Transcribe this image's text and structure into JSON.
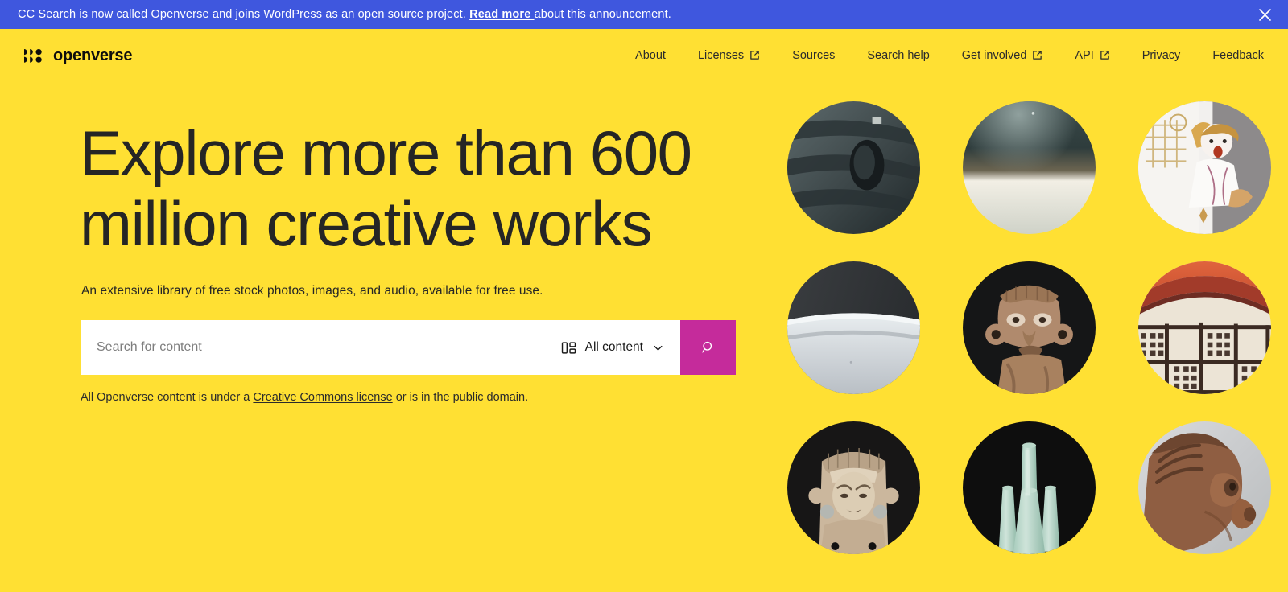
{
  "banner": {
    "text_before": "CC Search is now called Openverse and joins WordPress as an open source project. ",
    "link_label": "Read more ",
    "text_after": "about this announcement.",
    "close_icon": "close-icon",
    "background_color": "#3F57DE",
    "text_color": "#FFFFFF"
  },
  "header": {
    "brand_name": "openverse",
    "logo_icon": "openverse-logo-icon",
    "background_color": "#FFE033",
    "nav": [
      {
        "label": "About",
        "external": false
      },
      {
        "label": "Licenses",
        "external": true
      },
      {
        "label": "Sources",
        "external": false
      },
      {
        "label": "Search help",
        "external": false
      },
      {
        "label": "Get involved",
        "external": true
      },
      {
        "label": "API",
        "external": true
      },
      {
        "label": "Privacy",
        "external": false
      },
      {
        "label": "Feedback",
        "external": false
      }
    ]
  },
  "hero": {
    "headline": "Explore more than 600 million creative works",
    "subheadline": "An extensive library of free stock photos, images, and audio, available for free use.",
    "license_note_before": "All Openverse content is under a ",
    "license_note_link": "Creative Commons license",
    "license_note_after": " or is in the public domain."
  },
  "search": {
    "placeholder": "Search for content",
    "value": "",
    "content_type_label": "All content",
    "content_type_icon": "content-type-icon",
    "chevron_icon": "chevron-down-icon",
    "submit_icon": "search-icon",
    "submit_color": "#C52B9B"
  },
  "collage": {
    "items": [
      {
        "name": "dark-stone-carving",
        "alt": "Dark carved stone sculpture detail"
      },
      {
        "name": "glazed-ceramic-vessel",
        "alt": "Dark green and cream glazed ceramic vessel"
      },
      {
        "name": "porcelain-figurine",
        "alt": "Painted porcelain figurine of a child"
      },
      {
        "name": "white-ceramic-bowl",
        "alt": "White and grey ceramic bowl"
      },
      {
        "name": "terracotta-head-figure",
        "alt": "Terracotta figure with large ear ornaments"
      },
      {
        "name": "painted-clay-pot",
        "alt": "Terracotta pot with checkerboard painted pattern"
      },
      {
        "name": "carved-stone-deity",
        "alt": "Carved stone deity figure with headdress"
      },
      {
        "name": "celadon-multi-spout-vase",
        "alt": "Pale green celadon multi-spout vase"
      },
      {
        "name": "clay-profile-head",
        "alt": "Clay head sculpture in profile"
      }
    ]
  }
}
